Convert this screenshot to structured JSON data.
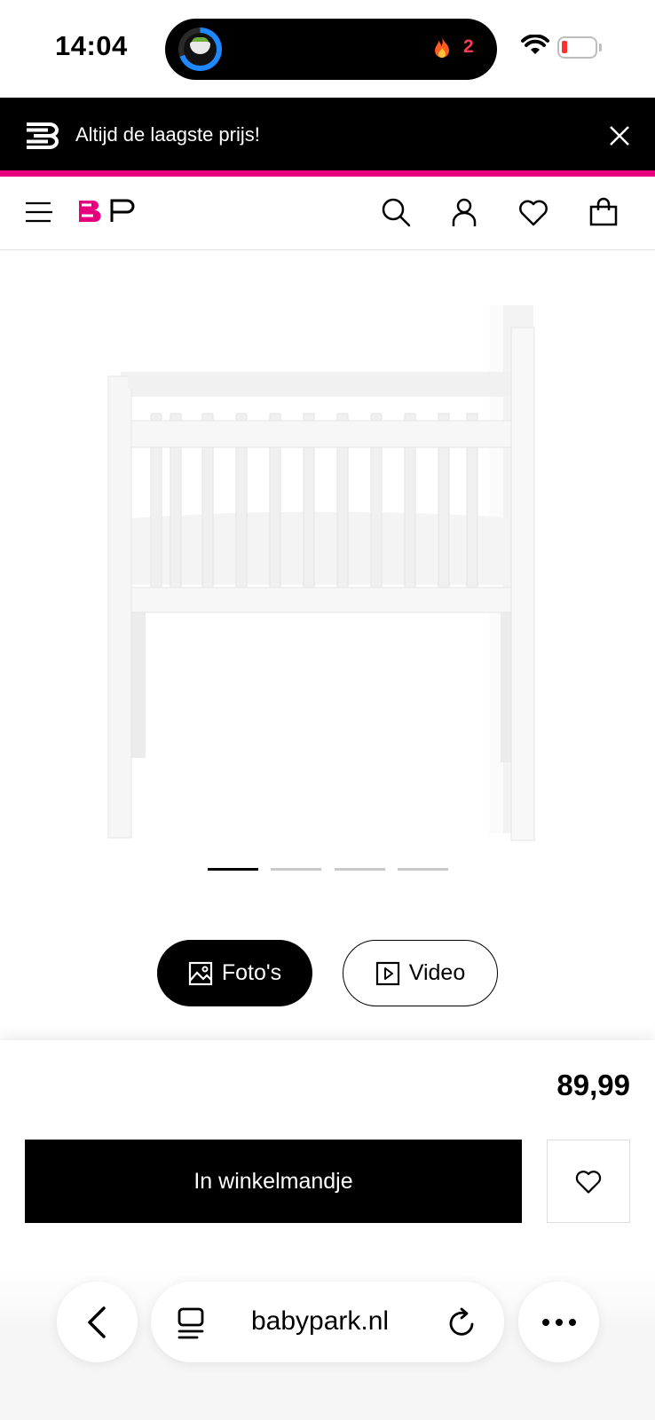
{
  "status_bar": {
    "time": "14:04",
    "island_count": "2",
    "icons": [
      "food-app-icon",
      "fire-icon",
      "wifi-icon",
      "battery-icon"
    ],
    "battery_color": "#ff3030"
  },
  "promo": {
    "text": "Altijd de laagste prijs!",
    "accent_color": "#e6007e"
  },
  "header": {
    "brand": "BP",
    "icons": [
      "menu-icon",
      "search-icon",
      "account-icon",
      "wishlist-icon",
      "cart-icon"
    ]
  },
  "gallery": {
    "image_alt": "Witte wieg",
    "slides_total": 4,
    "active_slide": 1,
    "photos_label": "Foto's",
    "video_label": "Video"
  },
  "product": {
    "price": "89,99",
    "add_to_cart_label": "In winkelmandje"
  },
  "browser": {
    "url": "babypark.nl"
  }
}
